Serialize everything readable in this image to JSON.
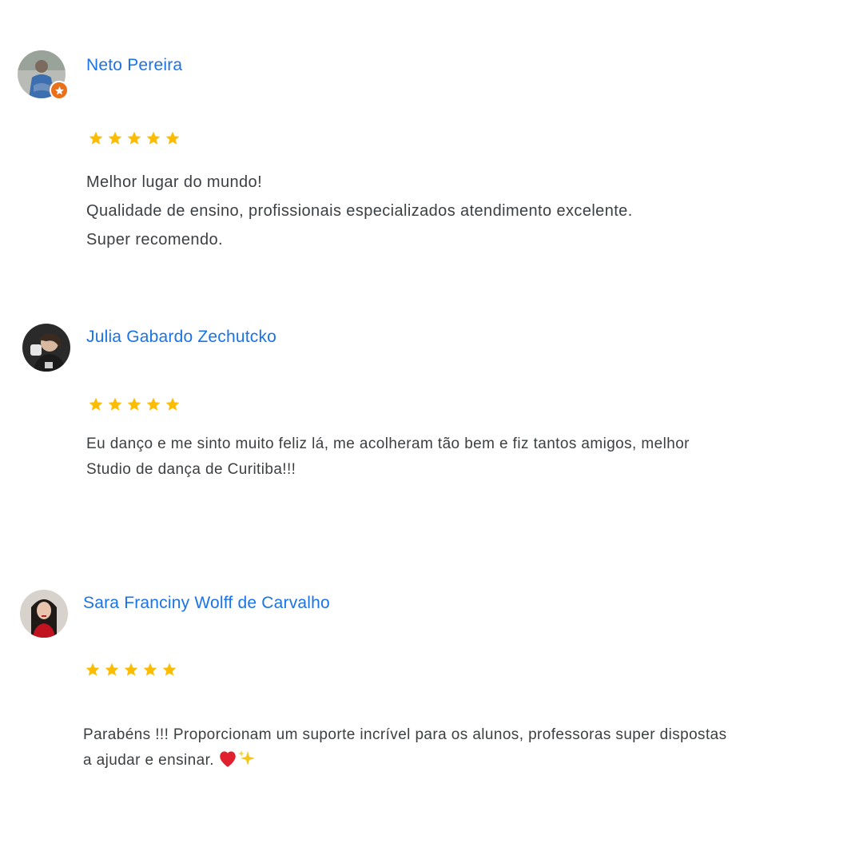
{
  "reviews": [
    {
      "author": "Neto Pereira",
      "rating": 5,
      "local_guide": true,
      "text": "Melhor lugar do mundo!\nQualidade de ensino, profissionais especializados atendimento excelente.\nSuper recomendo."
    },
    {
      "author": "Julia Gabardo Zechutcko",
      "rating": 5,
      "local_guide": false,
      "text": "Eu danço e me sinto muito feliz lá, me acolheram tão bem e fiz tantos amigos, melhor\nStudio de dança de Curitiba!!!"
    },
    {
      "author": "Sara Franciny Wolff de Carvalho",
      "rating": 5,
      "local_guide": false,
      "text": "Parabéns !!! Proporcionam um suporte incrível para os alunos, professoras super dispostas\na ajudar e ensinar.",
      "emojis": [
        "heart-emoji",
        "sparkles-emoji"
      ]
    }
  ],
  "colors": {
    "name": "#1a73e8",
    "star": "#fbbc04",
    "text": "#3c4043",
    "badge": "#e8711a"
  }
}
